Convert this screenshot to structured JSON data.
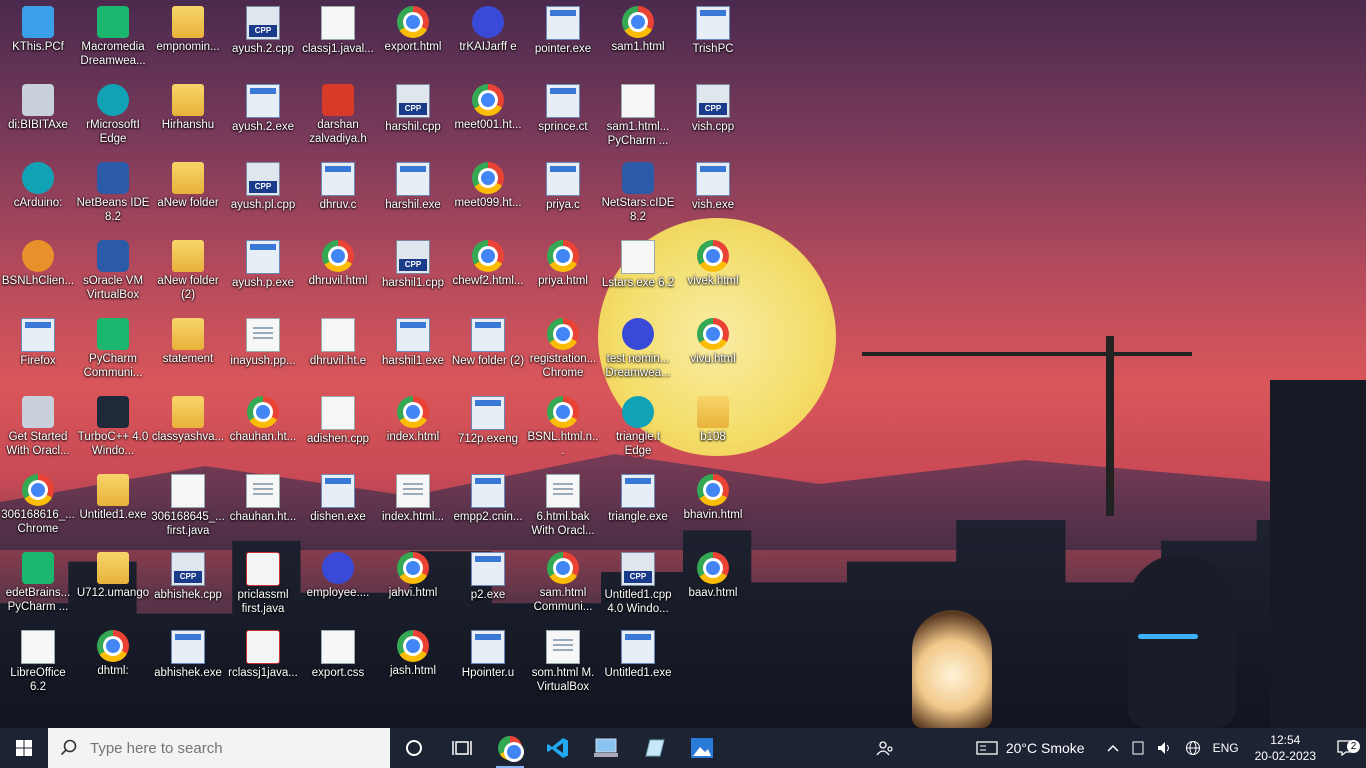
{
  "desktop_icons": [
    {
      "label": "KThis.PCf",
      "type": "pc"
    },
    {
      "label": "Macromedia Dreamwea...",
      "type": "green"
    },
    {
      "label": "empnomin...",
      "type": "folder"
    },
    {
      "label": "ayush.2.cpp",
      "type": "cpp"
    },
    {
      "label": "classj1.javal...",
      "type": "doc"
    },
    {
      "label": "export.html",
      "type": "chrome"
    },
    {
      "label": "trKAIJarff e",
      "type": "purple"
    },
    {
      "label": "pointer.exe",
      "type": "exe"
    },
    {
      "label": "sam1.html",
      "type": "chrome"
    },
    {
      "label": "TrishPC",
      "type": "exe"
    },
    {
      "label": "di:BIBITAxe",
      "type": "db"
    },
    {
      "label": "rMicrosoftI Edge",
      "type": "teal"
    },
    {
      "label": "Hirhanshu",
      "type": "folder"
    },
    {
      "label": "ayush.2.exe",
      "type": "exe"
    },
    {
      "label": "darshan zalvadiya.h",
      "type": "red"
    },
    {
      "label": "harshil.cpp",
      "type": "cpp"
    },
    {
      "label": "meet001.ht...",
      "type": "chrome"
    },
    {
      "label": "sprince.ct",
      "type": "exe"
    },
    {
      "label": "sam1.html... PyCharm ...",
      "type": "doc"
    },
    {
      "label": "vish.cpp",
      "type": "cpp"
    },
    {
      "label": "cArduino:",
      "type": "teal"
    },
    {
      "label": "NetBeans IDE 8.2",
      "type": "app"
    },
    {
      "label": "aNew folder",
      "type": "folder"
    },
    {
      "label": "ayush.pl.cpp",
      "type": "cpp"
    },
    {
      "label": "dhruv.c",
      "type": "exe"
    },
    {
      "label": "harshil.exe",
      "type": "exe"
    },
    {
      "label": "meet099.ht...",
      "type": "chrome"
    },
    {
      "label": "priya.c",
      "type": "exe"
    },
    {
      "label": "NetStars.cIDE 8.2",
      "type": "app"
    },
    {
      "label": "vish.exe",
      "type": "exe"
    },
    {
      "label": "BSNLhClien...",
      "type": "orange"
    },
    {
      "label": "sOracle VM VirtualBox",
      "type": "app"
    },
    {
      "label": "aNew folder (2)",
      "type": "folder"
    },
    {
      "label": "ayush.p.exe",
      "type": "exe"
    },
    {
      "label": "dhruvil.html",
      "type": "chrome"
    },
    {
      "label": "harshil1.cpp",
      "type": "cpp"
    },
    {
      "label": "chewf2.html...",
      "type": "chrome"
    },
    {
      "label": "priya.html",
      "type": "chrome"
    },
    {
      "label": "Lstars.exe 6.2",
      "type": "doc"
    },
    {
      "label": "vivek.html",
      "type": "chrome"
    },
    {
      "label": "Firefox",
      "type": "exe"
    },
    {
      "label": "PyCharm Communi...",
      "type": "green"
    },
    {
      "label": "statement",
      "type": "folder"
    },
    {
      "label": "inayush.pp...",
      "type": "file"
    },
    {
      "label": "dhruvil.ht.e",
      "type": "doc"
    },
    {
      "label": "harshil1.exe",
      "type": "exe"
    },
    {
      "label": "New folder (2)",
      "type": "exe"
    },
    {
      "label": "registration... Chrome",
      "type": "chrome"
    },
    {
      "label": "test nomin... Dreamwea...",
      "type": "purple"
    },
    {
      "label": "vivu.html",
      "type": "chrome"
    },
    {
      "label": "Get Started With Oracl...",
      "type": "db"
    },
    {
      "label": "TurboC++ 4.0 Windo...",
      "type": "dark"
    },
    {
      "label": "classyashva...",
      "type": "folder"
    },
    {
      "label": "chauhan.ht...",
      "type": "chrome"
    },
    {
      "label": "adishen.cpp",
      "type": "doc"
    },
    {
      "label": "index.html",
      "type": "chrome"
    },
    {
      "label": "712p.exeng",
      "type": "exe"
    },
    {
      "label": "BSNL.html.n...",
      "type": "chrome"
    },
    {
      "label": "triangle.t Edge",
      "type": "teal"
    },
    {
      "label": "b108",
      "type": "folder"
    },
    {
      "label": "306168616_... Chrome",
      "type": "chrome"
    },
    {
      "label": "Untitled1.exe",
      "type": "folder"
    },
    {
      "label": "306168645_... first.java",
      "type": "doc"
    },
    {
      "label": "chauhan.ht...",
      "type": "file"
    },
    {
      "label": "dishen.exe",
      "type": "exe"
    },
    {
      "label": "index.html...",
      "type": "file"
    },
    {
      "label": "empp2.cnin...",
      "type": "exe"
    },
    {
      "label": "6.html.bak With Oracl...",
      "type": "file"
    },
    {
      "label": "triangle.exe",
      "type": "exe"
    },
    {
      "label": "bhavin.html",
      "type": "chrome"
    },
    {
      "label": "edetBrains... PyCharm ...",
      "type": "green"
    },
    {
      "label": "U712.umango",
      "type": "folder"
    },
    {
      "label": "abhishek.cpp",
      "type": "cpp"
    },
    {
      "label": "priclassml first.java",
      "type": "java"
    },
    {
      "label": "employee....",
      "type": "purple"
    },
    {
      "label": "jahvi.html",
      "type": "chrome"
    },
    {
      "label": "p2.exe",
      "type": "exe"
    },
    {
      "label": "sam.html Communi...",
      "type": "chrome"
    },
    {
      "label": "Untitled1.cpp 4.0 Windo...",
      "type": "cpp"
    },
    {
      "label": "baav.html",
      "type": "chrome"
    },
    {
      "label": "LibreOffice 6.2",
      "type": "doc"
    },
    {
      "label": "dhtml:",
      "type": "chrome"
    },
    {
      "label": "abhishek.exe",
      "type": "exe"
    },
    {
      "label": "rclassj1java...",
      "type": "java"
    },
    {
      "label": "export.css",
      "type": "doc"
    },
    {
      "label": "jash.html",
      "type": "chrome"
    },
    {
      "label": "Hpointer.u",
      "type": "exe"
    },
    {
      "label": "som.html M. VirtualBox",
      "type": "file"
    },
    {
      "label": "Untitled1.exe",
      "type": "exe"
    },
    {
      "label": "",
      "type": "none"
    }
  ],
  "taskbar": {
    "search_placeholder": "Type here to search",
    "weather": "20°C  Smoke",
    "language": "ENG",
    "time": "12:54",
    "date": "20-02-2023",
    "notification_count": "2",
    "pinned": [
      "chrome-icon",
      "vscode-icon",
      "computer-icon",
      "notes-icon",
      "photos-icon"
    ]
  }
}
